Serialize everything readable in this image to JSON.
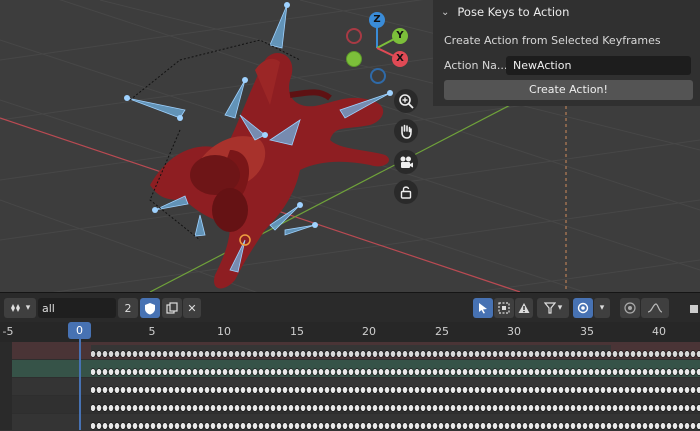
{
  "viewport": {
    "gizmo": {
      "z": "Z",
      "y": "Y",
      "x": "X"
    },
    "colors": {
      "x": "#e04a55",
      "y": "#7cbf3a",
      "z": "#3a8cd8"
    }
  },
  "panel": {
    "title": "Pose Keys to Action",
    "description": "Create Action from Selected Keyframes",
    "action_name_label": "Action Na...",
    "action_name_value": "NewAction",
    "create_button": "Create Action!"
  },
  "toolbar": {
    "filter_value": "all",
    "count": "2"
  },
  "timeline": {
    "ticks": [
      "-5",
      "0",
      "5",
      "10",
      "15",
      "20",
      "25",
      "30",
      "35",
      "40"
    ],
    "current_frame": "0"
  }
}
